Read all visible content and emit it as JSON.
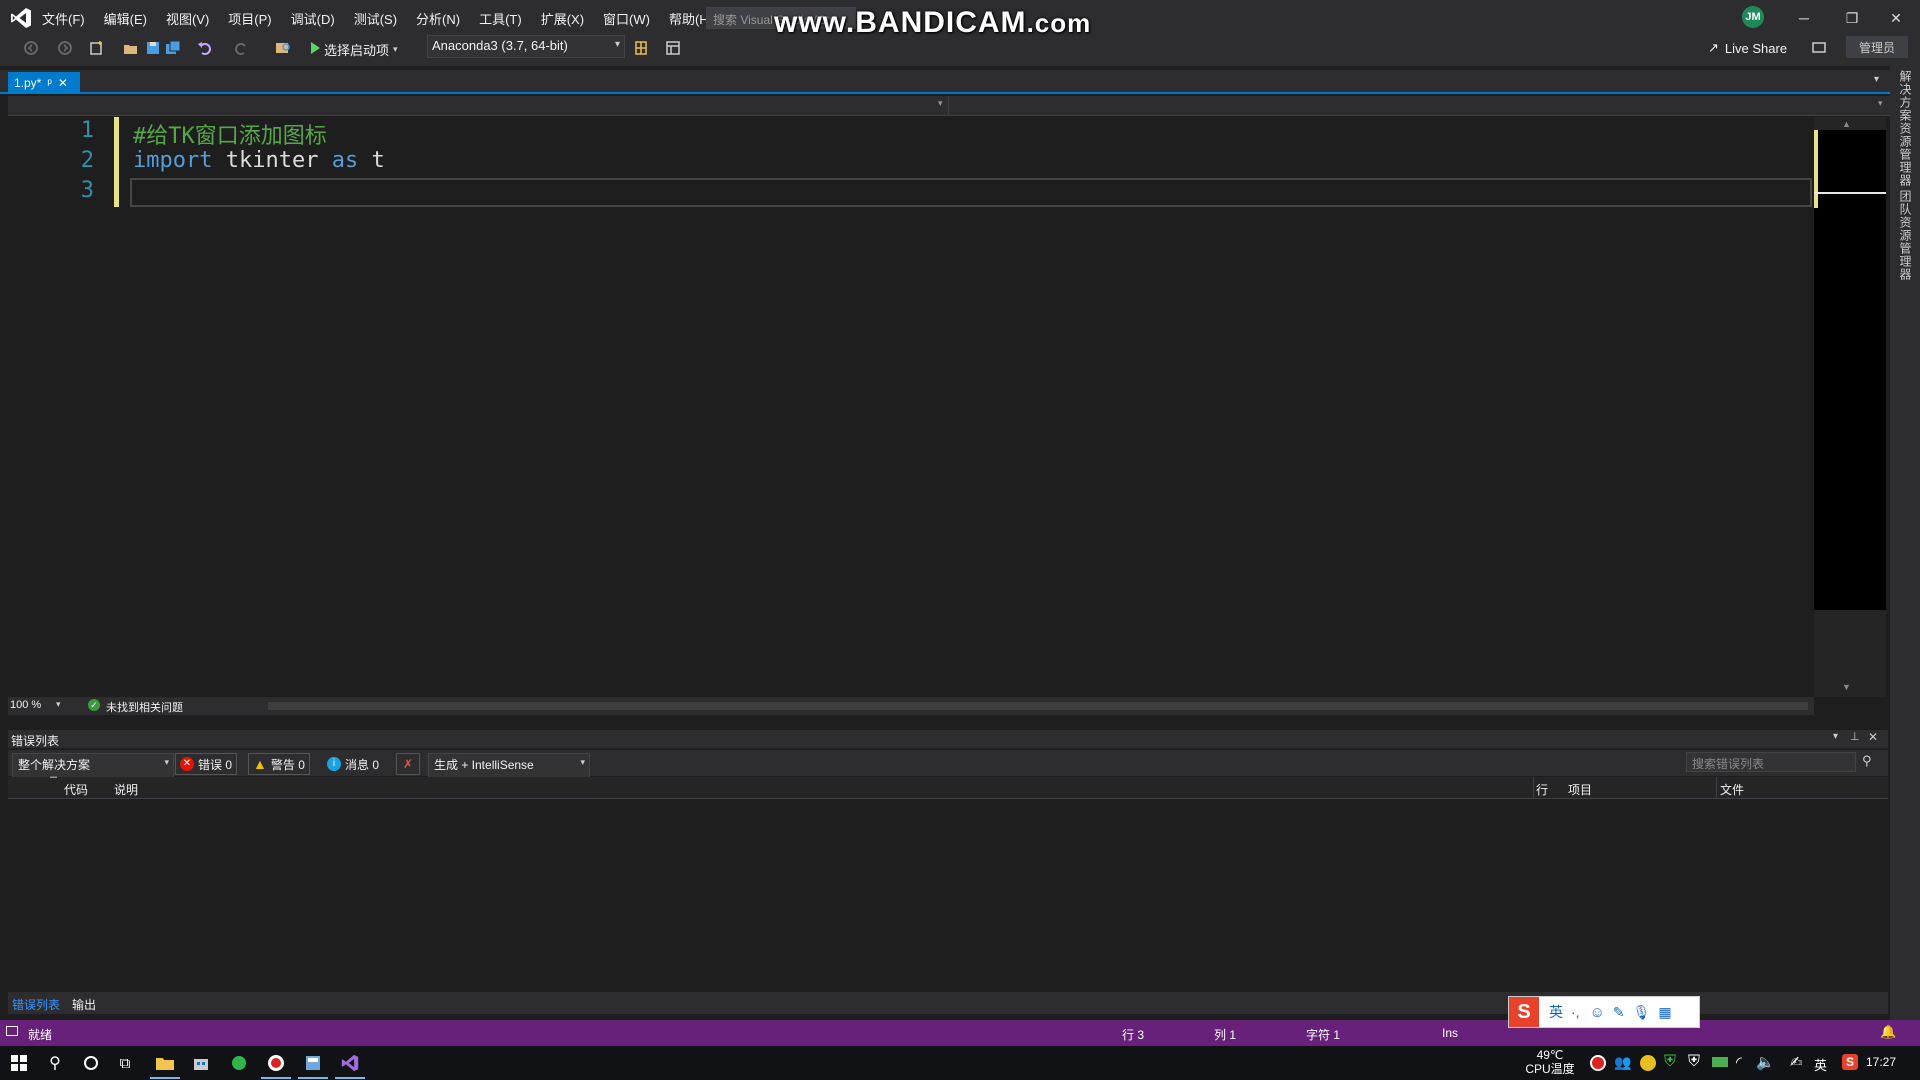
{
  "window": {
    "menu": [
      "文件(F)",
      "编辑(E)",
      "视图(V)",
      "项目(P)",
      "调试(D)",
      "测试(S)",
      "分析(N)",
      "工具(T)",
      "扩展(X)",
      "窗口(W)",
      "帮助(H)"
    ],
    "search_placeholder": "搜索 Visual Studio (Ctrl",
    "watermark_a": "www.",
    "watermark_b": "BANDICAM",
    "watermark_c": ".com",
    "avatar": "JM"
  },
  "toolbar": {
    "start_item": "选择启动项",
    "environment": "Anaconda3 (3.7, 64-bit)",
    "live_share": "Live Share",
    "admin": "管理员"
  },
  "tab": {
    "name": "1.py*",
    "pin": "ᵖ",
    "close": "✕"
  },
  "editor": {
    "lines": [
      {
        "n": "1",
        "text": "#给TK窗口添加图标"
      },
      {
        "n": "2",
        "kw1": "import",
        "ident": " tkinter ",
        "kw2": "as",
        "ident2": " t"
      },
      {
        "n": "3"
      }
    ],
    "zoom": "100 %",
    "issues": "未找到相关问题"
  },
  "side_panel": {
    "solution_explorer": "解决方案资源管理器",
    "team_explorer": "团队资源管理器"
  },
  "error_list": {
    "title": "错误列表",
    "scope": "整个解决方案",
    "errors": "错误 0",
    "warnings": "警告 0",
    "messages": "消息 0",
    "build_filter": "生成 + IntelliSense",
    "search_placeholder": "搜索错误列表",
    "columns": {
      "code": "代码",
      "desc": "说明",
      "line": "行",
      "project": "项目",
      "file": "文件"
    },
    "tabs": [
      "错误列表",
      "输出"
    ]
  },
  "statusbar": {
    "ready": "就绪",
    "row": "行 3",
    "col": "列 1",
    "char": "字符 1",
    "ins": "Ins"
  },
  "ime": {
    "lang": "英",
    "punct": "·,"
  },
  "taskbar": {
    "temp": "49℃",
    "temp_label": "CPU温度",
    "lang": "英",
    "time": "17:27"
  },
  "colors": {
    "accent": "#007acc",
    "statusbar": "#68217a",
    "comment": "#57a64a",
    "keyword": "#569cd6"
  }
}
